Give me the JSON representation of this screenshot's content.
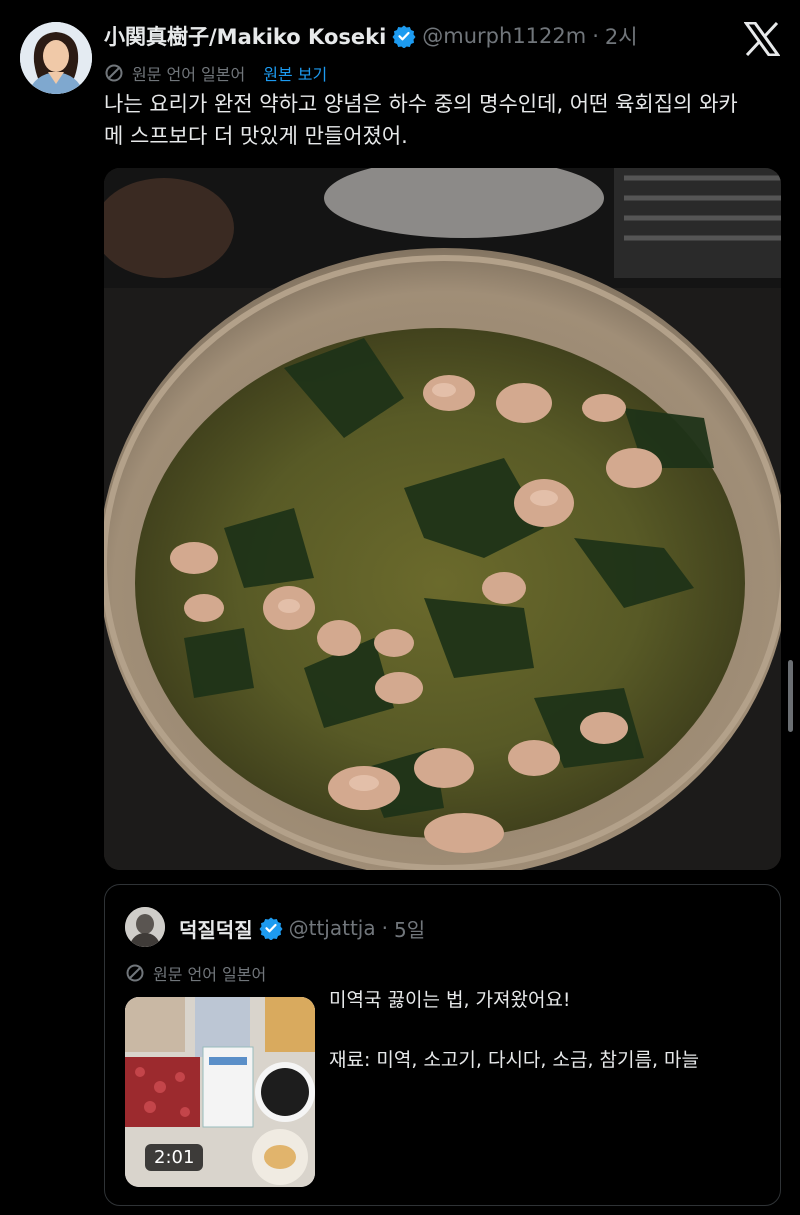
{
  "tweet": {
    "author_name": "小関真樹子/Makiko Koseki",
    "handle": "@murph1122m",
    "separator": "·",
    "time": "2시",
    "translation_note": "원문 언어 일본어",
    "show_original": "원본 보기",
    "text_line1": "나는 요리가 완전 약하고 양념은 하수 중의 명수인데, 어떤 육회집의 와카",
    "text_line2": "메 스프보다 더 맛있게 만들어졌어."
  },
  "quote": {
    "author_name": "덕질덕질",
    "handle": "@ttjattja",
    "separator": "·",
    "time": "5일",
    "translation_note": "원문 언어 일본어",
    "text_title": "미역국 끓이는 법, 가져왔어요!",
    "text_ingredients": "재료: 미역, 소고기, 다시다, 소금, 참기름, 마늘",
    "video_duration": "2:01"
  },
  "icons": {
    "verified": "verified-badge-icon",
    "x_logo": "x-logo-icon",
    "translate": "translate-icon"
  },
  "colors": {
    "background": "#000000",
    "text": "#e7e9ea",
    "secondary": "#71767b",
    "accent": "#1d9bf0"
  }
}
